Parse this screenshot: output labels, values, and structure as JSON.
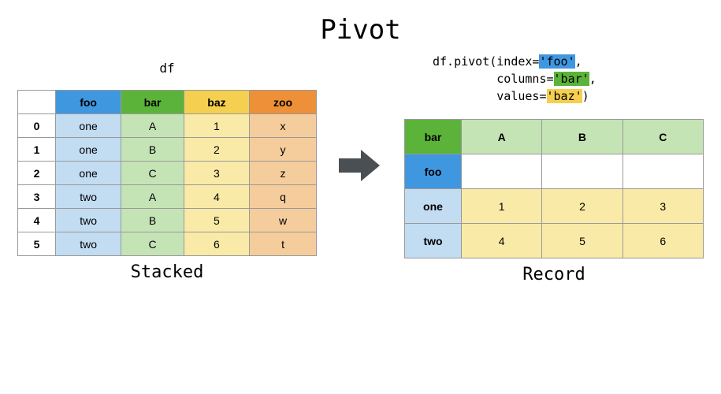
{
  "title": "Pivot",
  "left": {
    "name_label": "df",
    "headers": [
      "foo",
      "bar",
      "baz",
      "zoo"
    ],
    "rows": [
      {
        "idx": "0",
        "foo": "one",
        "bar": "A",
        "baz": "1",
        "zoo": "x"
      },
      {
        "idx": "1",
        "foo": "one",
        "bar": "B",
        "baz": "2",
        "zoo": "y"
      },
      {
        "idx": "2",
        "foo": "one",
        "bar": "C",
        "baz": "3",
        "zoo": "z"
      },
      {
        "idx": "3",
        "foo": "two",
        "bar": "A",
        "baz": "4",
        "zoo": "q"
      },
      {
        "idx": "4",
        "foo": "two",
        "bar": "B",
        "baz": "5",
        "zoo": "w"
      },
      {
        "idx": "5",
        "foo": "two",
        "bar": "C",
        "baz": "6",
        "zoo": "t"
      }
    ],
    "caption": "Stacked"
  },
  "code": {
    "l1a": "df.pivot(index=",
    "l1b": "'foo'",
    "l1c": ",",
    "l2a": "         columns=",
    "l2b": "'bar'",
    "l2c": ",",
    "l3a": "         values=",
    "l3b": "'baz'",
    "l3c": ")"
  },
  "right": {
    "corner_bar": "bar",
    "corner_foo": "foo",
    "cols": [
      "A",
      "B",
      "C"
    ],
    "rows": [
      {
        "idx": "one",
        "vals": [
          "1",
          "2",
          "3"
        ]
      },
      {
        "idx": "two",
        "vals": [
          "4",
          "5",
          "6"
        ]
      }
    ],
    "caption": "Record"
  }
}
